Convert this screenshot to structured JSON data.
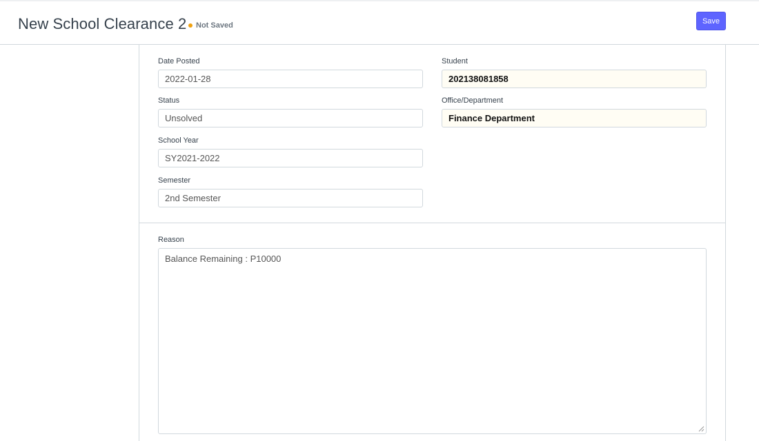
{
  "header": {
    "title": "New School Clearance 2",
    "indicator": "Not Saved",
    "save_label": "Save"
  },
  "fields": {
    "date_posted": {
      "label": "Date Posted",
      "value": "2022-01-28"
    },
    "status": {
      "label": "Status",
      "value": "Unsolved"
    },
    "school_year": {
      "label": "School Year",
      "value": "SY2021-2022"
    },
    "semester": {
      "label": "Semester",
      "value": "2nd Semester"
    },
    "student": {
      "label": "Student",
      "value": "202138081858"
    },
    "office_department": {
      "label": "Office/Department",
      "value": "Finance Department"
    },
    "reason": {
      "label": "Reason",
      "value": "Balance Remaining : P10000"
    }
  },
  "colors": {
    "accent": "#5e64ff",
    "indicator_dot": "#f0a10f",
    "link_field_bg": "#fffdf4"
  }
}
